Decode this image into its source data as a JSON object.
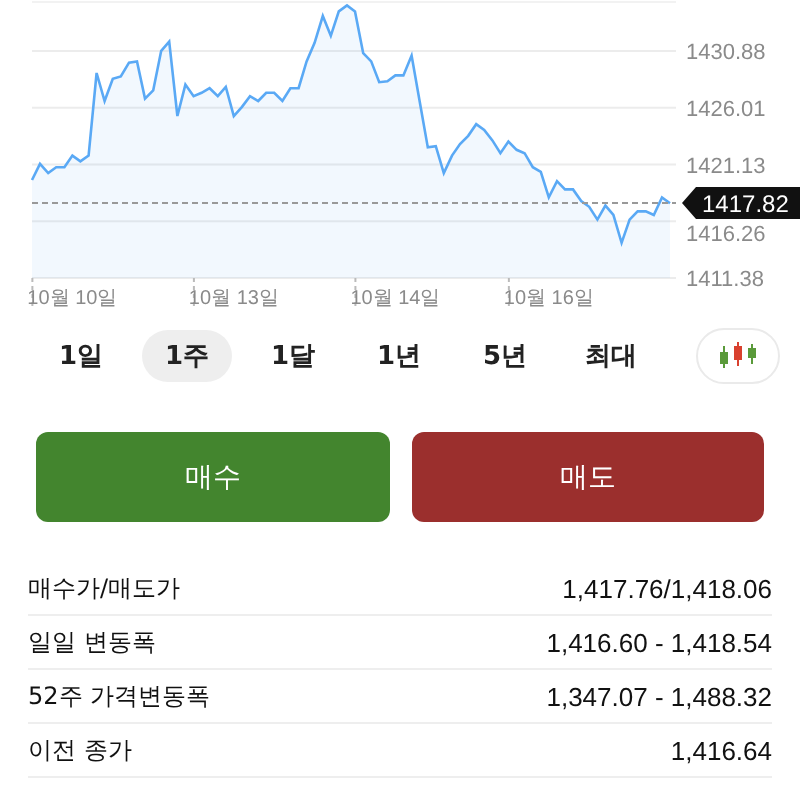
{
  "chart": {
    "chart_data": {
      "type": "area",
      "grid": true,
      "ref_lines": [
        {
          "axis": "y",
          "value": 1417.82,
          "label": "1417.82"
        }
      ],
      "categories": [
        null,
        null,
        null,
        null,
        null,
        "10월 10일",
        null,
        null,
        null,
        null,
        null,
        null,
        null,
        null,
        null,
        null,
        null,
        null,
        null,
        null,
        null,
        null,
        null,
        null,
        null,
        "10월 13일",
        null,
        null,
        null,
        null,
        null,
        null,
        null,
        null,
        null,
        null,
        null,
        null,
        null,
        null,
        null,
        null,
        null,
        null,
        null,
        "10월 14일",
        null,
        null,
        null,
        null,
        null,
        null,
        null,
        null,
        null,
        null,
        null,
        null,
        null,
        null,
        null,
        null,
        null,
        null,
        "10월 16일",
        null,
        null,
        null,
        null,
        null,
        null,
        null,
        null,
        null,
        null,
        null,
        null,
        null,
        null,
        null
      ],
      "ylim": [
        1411.38,
        1435.1
      ],
      "series": [
        {
          "color": "#5aa9f5",
          "values": [
            1419.8,
            1421.2,
            1420.4,
            1420.9,
            1420.9,
            1421.9,
            1421.4,
            1421.9,
            1429.0,
            1426.6,
            1428.5,
            1428.7,
            1429.9,
            1430.0,
            1426.8,
            1427.5,
            1430.9,
            1431.7,
            1425.3,
            1428.0,
            1427.0,
            1427.3,
            1427.7,
            1427.0,
            1427.8,
            1425.3,
            1426.1,
            1427.0,
            1426.6,
            1427.3,
            1427.3,
            1426.6,
            1427.7,
            1427.7,
            1430.0,
            1431.6,
            1433.9,
            1432.2,
            1434.3,
            1434.8,
            1434.3,
            1430.7,
            1430.0,
            1428.2,
            1428.3,
            1428.8,
            1428.8,
            1430.5,
            1426.6,
            1422.6,
            1422.7,
            1420.4,
            1421.9,
            1422.9,
            1423.6,
            1424.6,
            1424.1,
            1423.2,
            1422.1,
            1423.1,
            1422.4,
            1422.1,
            1420.9,
            1420.5,
            1418.3,
            1419.7,
            1419.0,
            1419.0,
            1418.0,
            1417.5,
            1416.4,
            1417.6,
            1416.8,
            1414.4,
            1416.4,
            1417.1,
            1417.1,
            1416.8,
            1418.3,
            1417.8
          ]
        }
      ],
      "yticks": [
        {
          "value": 1430.88,
          "label": "1430.88"
        },
        {
          "value": 1426.01,
          "label": "1426.01"
        },
        {
          "value": 1421.13,
          "label": "1421.13"
        },
        {
          "value": 1416.26,
          "label": "1416.26"
        },
        {
          "value": 1411.38,
          "label": "1411.38"
        }
      ]
    }
  },
  "periods": [
    {
      "label": "1일",
      "selected": false
    },
    {
      "label": "1주",
      "selected": true
    },
    {
      "label": "1달",
      "selected": false
    },
    {
      "label": "1년",
      "selected": false
    },
    {
      "label": "5년",
      "selected": false
    },
    {
      "label": "최대",
      "selected": false
    }
  ],
  "actions": [
    {
      "label": "매수",
      "kind": "buy"
    },
    {
      "label": "매도",
      "kind": "sell"
    }
  ],
  "stats": [
    {
      "label": "매수가/매도가",
      "value": "1,417.76/1,418.06"
    },
    {
      "label": "일일 변동폭",
      "value": "1,416.60 - 1,418.54"
    },
    {
      "label": "52주 가격변동폭",
      "value": "1,347.07 - 1,488.32"
    },
    {
      "label": "이전 종가",
      "value": "1,416.64"
    }
  ]
}
